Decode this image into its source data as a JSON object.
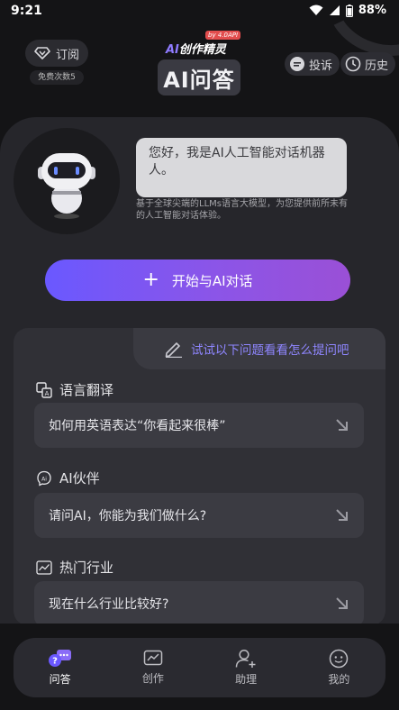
{
  "status": {
    "time": "9:21",
    "battery": "88%"
  },
  "header": {
    "subscribe_label": "订阅",
    "free_count": "免费次数5",
    "brand": {
      "ai": "AI",
      "name": "创作精灵",
      "badge": "by 4.0API"
    },
    "title": "AI问答",
    "complaint_label": "投诉",
    "history_label": "历史"
  },
  "intro": {
    "greeting": "您好，我是AI人工智能对话机器人。",
    "subtitle": "基于全球尖端的LLMs语言大模型，为您提供前所未有的人工智能对话体验。"
  },
  "start_button": {
    "label": "开始与AI对话"
  },
  "suggestions": {
    "tab_label": "试试以下问题看看怎么提问吧",
    "categories": [
      {
        "name": "语言翻译",
        "icon": "translate-icon",
        "question": "如何用英语表达“你看起来很棒”"
      },
      {
        "name": "AI伙伴",
        "icon": "ai-partner-icon",
        "question": "请问AI，你能为我们做什么?"
      },
      {
        "name": "热门行业",
        "icon": "trend-chart-icon",
        "question": "现在什么行业比较好?"
      }
    ]
  },
  "nav": {
    "items": [
      {
        "label": "问答",
        "icon": "qa-icon",
        "active": true
      },
      {
        "label": "创作",
        "icon": "create-icon",
        "active": false
      },
      {
        "label": "助理",
        "icon": "assistant-icon",
        "active": false
      },
      {
        "label": "我的",
        "icon": "profile-icon",
        "active": false
      }
    ]
  },
  "colors": {
    "accent": "#7b61ff",
    "gradient_end": "#9a50d6",
    "background": "#141416",
    "card": "#26262b"
  }
}
